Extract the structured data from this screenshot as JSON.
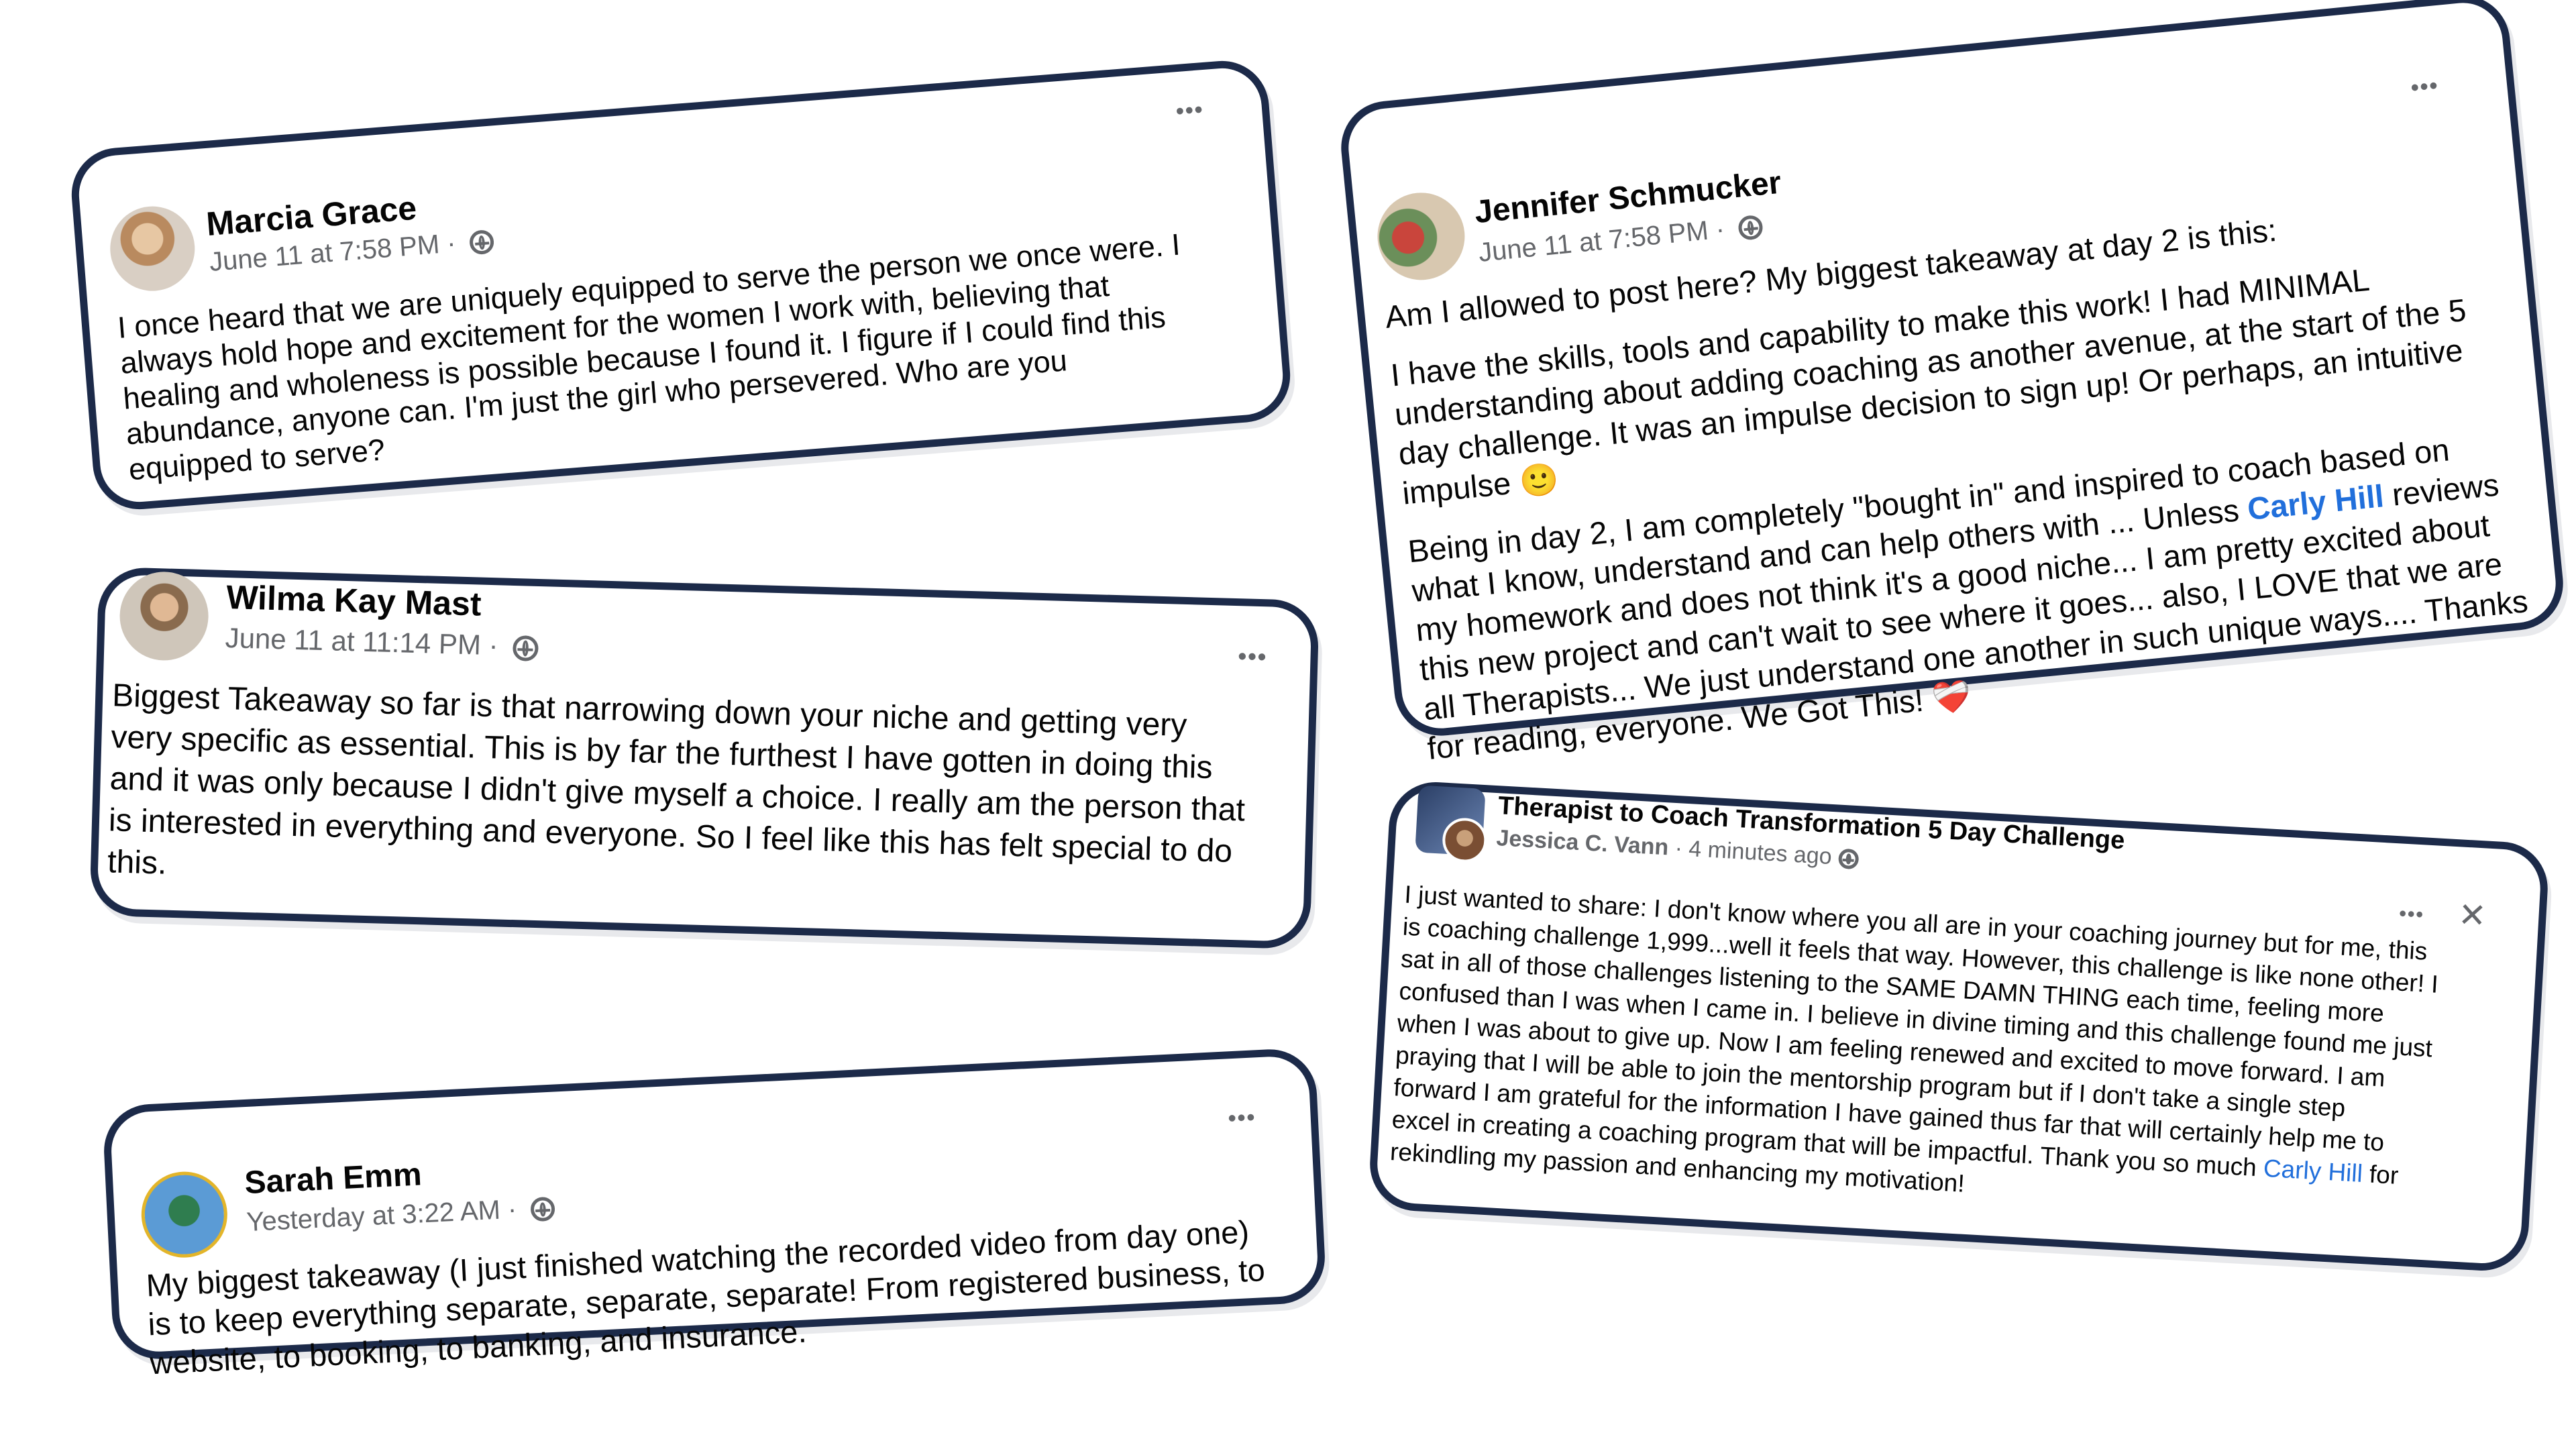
{
  "posts": {
    "marcia": {
      "name": "Marcia Grace",
      "time": "June 11 at 7:58 PM",
      "separator": " · ",
      "more_label": "•••",
      "lines": [
        "I once heard that we are uniquely equipped to serve the person we once were.  I",
        "always hold hope and excitement for the women I work with, believing that",
        "healing and wholeness is possible because I found it.  I figure if I could find this",
        "abundance, anyone can.  I'm just the girl who persevered.  Who are you",
        "equipped to serve?"
      ]
    },
    "wilma": {
      "name": "Wilma Kay Mast",
      "time": "June 11 at 11:14 PM",
      "separator": " · ",
      "more_label": "•••",
      "lines": [
        "Biggest Takeaway so far is that narrowing down your niche and getting very",
        "very specific as essential. This is by far the furthest I have gotten in doing this",
        "and it was only because I didn't give myself a choice. I really am the person that",
        "is interested in everything and everyone. So I feel like this has felt special to do",
        "this."
      ]
    },
    "sarah": {
      "name": "Sarah Emm",
      "time": "Yesterday at 3:22 AM",
      "separator": " · ",
      "more_label": "•••",
      "lines": [
        "My biggest takeaway (I just finished watching the recorded video from day one)",
        "is to keep everything separate, separate, separate! From registered business, to",
        "website, to booking, to banking, and insurance."
      ]
    },
    "jennifer": {
      "name": "Jennifer Schmucker",
      "time": "June 11 at 7:58 PM",
      "separator": " · ",
      "more_label": "•••",
      "line1": "Am I allowed to post here? My biggest takeaway at day 2 is this:",
      "para2": [
        "I have the skills, tools and capability to make this work! I had MINIMAL",
        "understanding about adding coaching as another avenue, at the start of the 5",
        "day challenge. It was an impulse decision to sign up! Or perhaps, an intuitive"
      ],
      "impulse_text": "impulse ",
      "impulse_emoji": "🙂",
      "para3_line1": "Being in day 2, I am completely \"bought in\" and inspired to coach based on",
      "para3_line2_pre": "what I know, understand and can help others with ... Unless ",
      "mention": "Carly Hill",
      "para3_line2_post": " reviews",
      "para3_rest": [
        "my homework and does not think it's a good niche...  I am pretty excited about",
        "this new project and can't wait to see where it goes... also, I LOVE that we are",
        "all Therapists... We just understand one another in such unique ways.... Thanks"
      ],
      "last_line": "for reading, everyone. We Got This! ",
      "heart_emoji": "❤️‍🩹"
    },
    "jessica": {
      "group": "Therapist to Coach Transformation 5 Day Challenge",
      "author": "Jessica C. Vann",
      "time": "4 minutes ago",
      "separator": " · ",
      "more_label": "•••",
      "close_label": "✕",
      "lines": [
        "I just wanted to share: I don't know where you all are in your coaching journey but for me, this",
        "is coaching challenge 1,999...well it feels that way. However, this challenge is like none other! I",
        "sat in all of those challenges listening to the SAME DAMN THING each time, feeling more",
        "confused than I was when I came in. I believe in divine timing and this challenge found me just",
        "when I was about to give up. Now I am feeling renewed and excited to move forward. I am",
        "praying that I will be able to join the mentorship program but if I don't take a single step",
        "forward I am grateful for the information I have gained thus far that will certainly help me to",
        "excel in creating a coaching program that will be impactful. Thank you so much "
      ],
      "mention": "Carly Hill",
      "after_mention": " for",
      "last_line": "rekindling my passion and enhancing my motivation!"
    }
  }
}
